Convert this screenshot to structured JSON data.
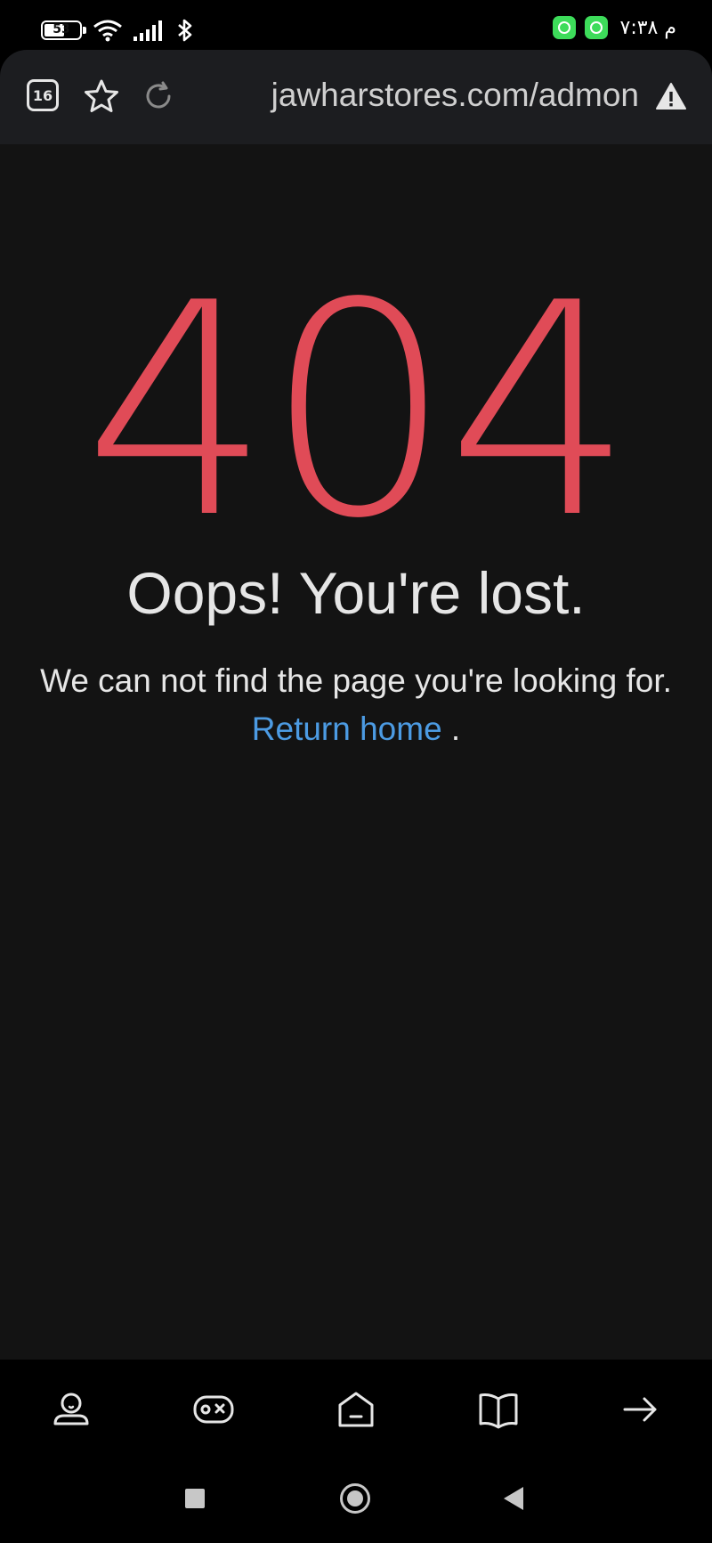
{
  "status_bar": {
    "battery_level": "53",
    "time": "م ٧:٣٨",
    "icons": [
      "battery-icon",
      "wifi-icon",
      "signal-icon",
      "bluetooth-icon",
      "app-notification-icon",
      "app-notification-icon"
    ]
  },
  "browser": {
    "tab_count": "16",
    "url": "jawharstores.com/admon",
    "icons": [
      "tabs-icon",
      "star-icon",
      "reload-icon",
      "warning-icon"
    ]
  },
  "page": {
    "error_code": "404",
    "heading": "Oops! You're lost.",
    "message": "We can not find the page you're looking for.",
    "return_link": "Return home",
    "trailing": " .",
    "colors": {
      "error": "#e04b57",
      "link": "#4c9be3",
      "background": "#131313"
    }
  },
  "bottom_nav": {
    "items": [
      "profile-icon",
      "games-icon",
      "home-icon",
      "book-icon",
      "forward-arrow-icon"
    ]
  },
  "system_nav": {
    "items": [
      "recents-button",
      "home-button",
      "back-button"
    ]
  }
}
